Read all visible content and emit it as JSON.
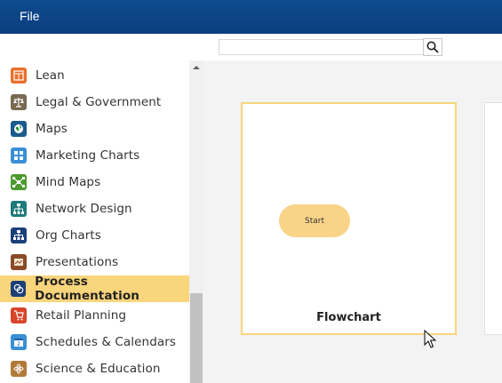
{
  "menubar": {
    "file_label": "File"
  },
  "search": {
    "value": "",
    "placeholder": ""
  },
  "sidebar": {
    "items": [
      {
        "label": "Lean",
        "icon": "lean-icon",
        "color": "#e8702a"
      },
      {
        "label": "Legal & Government",
        "icon": "scales-icon",
        "color": "#7a6a52"
      },
      {
        "label": "Maps",
        "icon": "globe-icon",
        "color": "#1a5a8c"
      },
      {
        "label": "Marketing Charts",
        "icon": "grid-icon",
        "color": "#3b8fd6"
      },
      {
        "label": "Mind Maps",
        "icon": "mindmap-icon",
        "color": "#4e9a2f"
      },
      {
        "label": "Network Design",
        "icon": "network-icon",
        "color": "#1f7a7a"
      },
      {
        "label": "Org Charts",
        "icon": "orgchart-icon",
        "color": "#1c3f78"
      },
      {
        "label": "Presentations",
        "icon": "presentation-icon",
        "color": "#8a4a2a"
      },
      {
        "label": "Process Documentation",
        "icon": "process-doc-icon",
        "color": "#1c3f78",
        "selected": true
      },
      {
        "label": "Retail Planning",
        "icon": "retail-icon",
        "color": "#d8462a"
      },
      {
        "label": "Schedules & Calendars",
        "icon": "calendar-icon",
        "color": "#3b8fd6"
      },
      {
        "label": "Science & Education",
        "icon": "atom-icon",
        "color": "#b07a3a"
      }
    ]
  },
  "templates": [
    {
      "title": "Flowchart",
      "shape_label": "Start"
    }
  ],
  "colors": {
    "menubar": "#0e4a8f",
    "accent": "#f9d57c",
    "shape_fill": "#f9d388"
  }
}
